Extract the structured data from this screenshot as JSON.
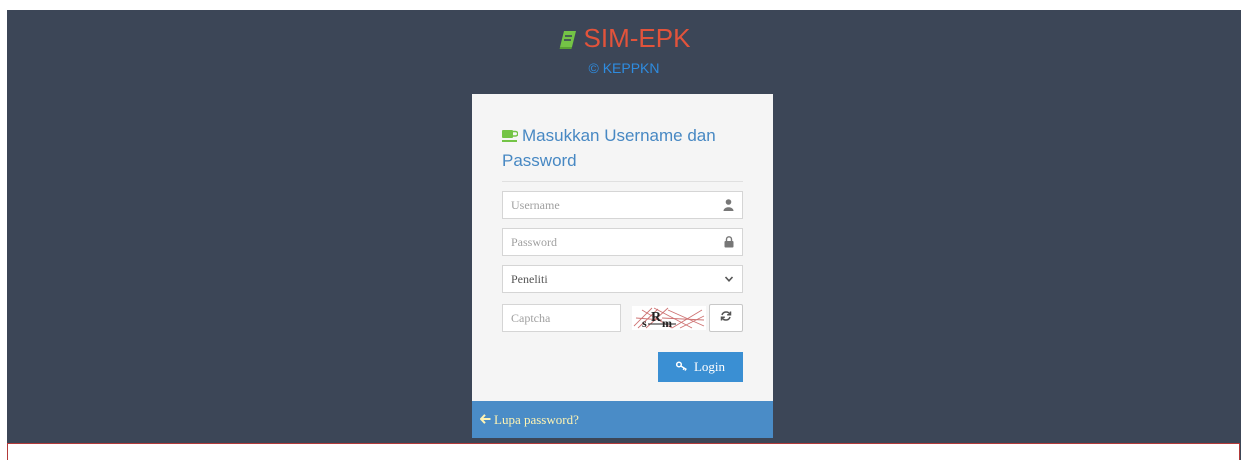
{
  "brand": {
    "title": "SIM-EPK",
    "copyright": "© KEPPKN",
    "icon": "book-icon"
  },
  "login": {
    "heading": "Masukkan Username dan Password",
    "heading_icon": "coffee-cup-icon",
    "username": {
      "value": "",
      "placeholder": "Username",
      "icon": "user-icon"
    },
    "password": {
      "value": "",
      "placeholder": "Password",
      "icon": "lock-icon"
    },
    "role": {
      "selected": "Peneliti",
      "icon": "chevron-down-icon"
    },
    "captcha": {
      "value": "",
      "placeholder": "Captcha",
      "refresh_icon": "refresh-icon"
    },
    "submit_label": "Login",
    "submit_icon": "key-icon",
    "forgot_label": "Lupa password?",
    "forgot_icon": "arrow-left-icon"
  },
  "colors": {
    "background": "#3c4657",
    "brand": "#e2533b",
    "book_icon": "#74c446",
    "link_blue": "#2e8ce0",
    "button": "#3a8fd3",
    "footer_bar": "#4a8cc7",
    "footer_text": "#fff4b3"
  }
}
